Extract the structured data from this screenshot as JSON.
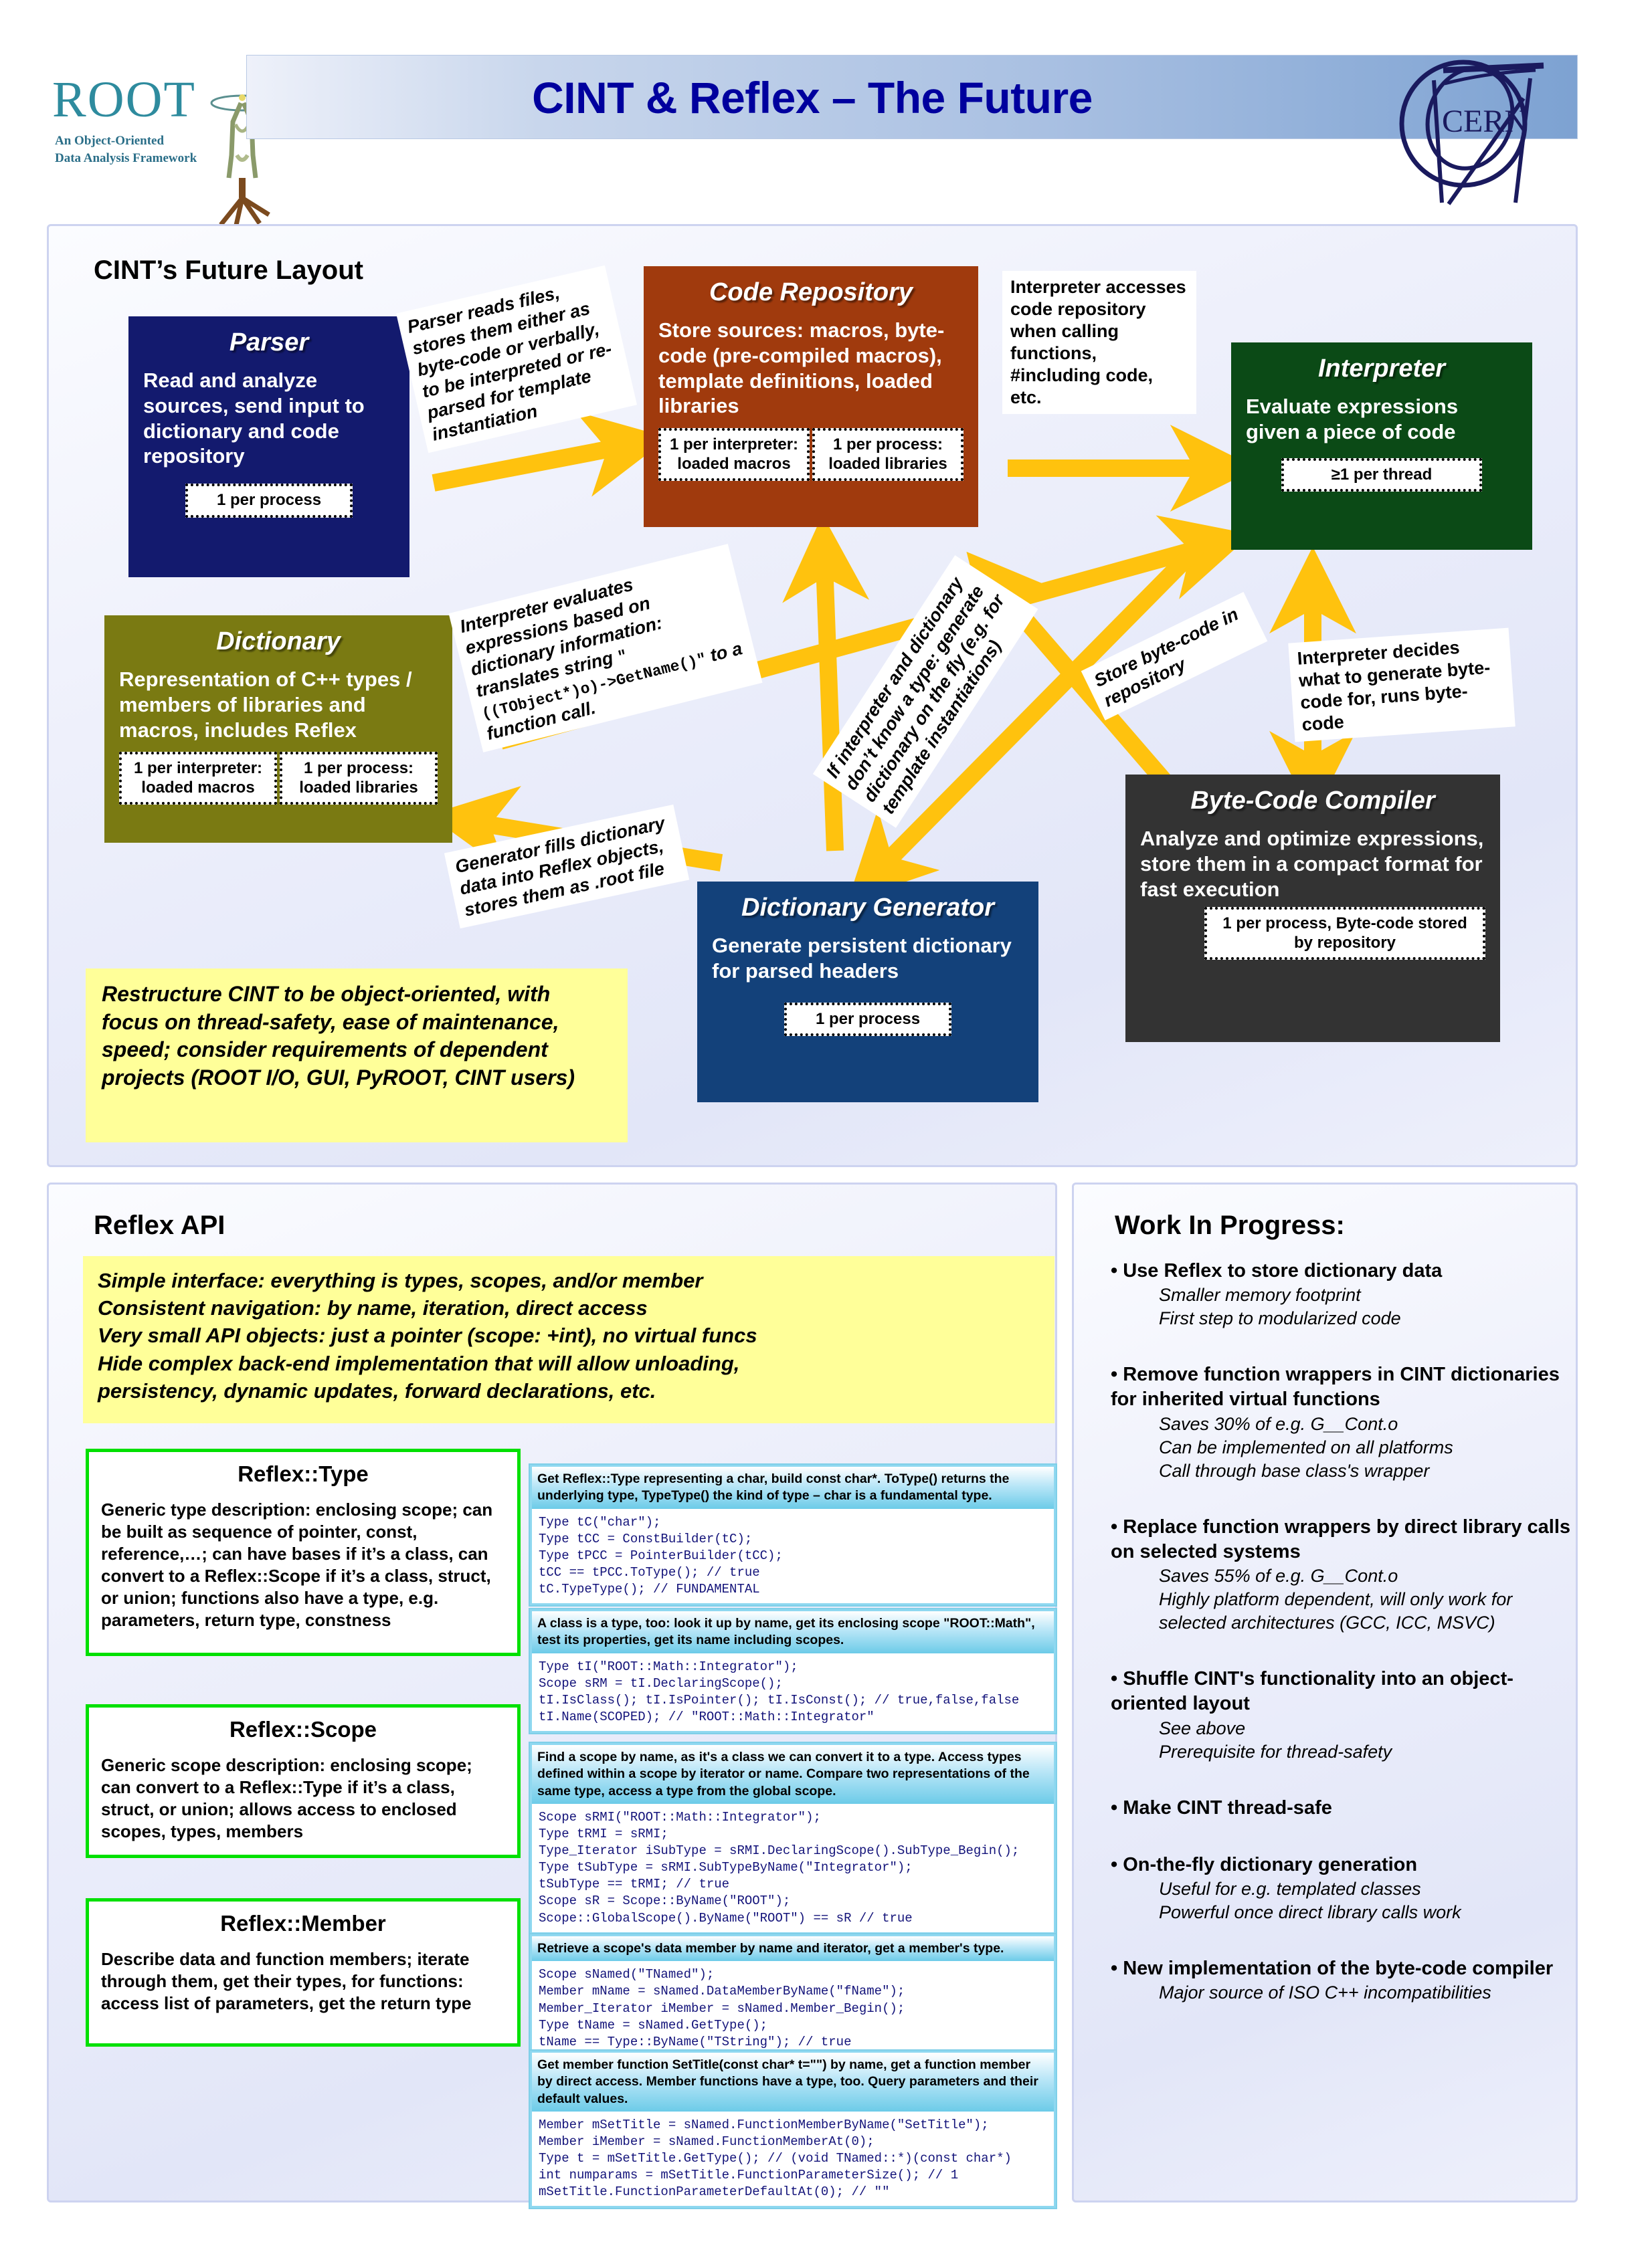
{
  "header": {
    "logo_word": "ROOT",
    "logo_tagline_1": "An Object-Oriented",
    "logo_tagline_2": "Data Analysis Framework",
    "title": "CINT & Reflex – The Future",
    "cern_label": "CERN"
  },
  "colors": {
    "title": "#00009E",
    "parser": "#131A6E",
    "code_repository": "#A03A0D",
    "interpreter": "#0B4A16",
    "dictionary": "#7A7A12",
    "dictionary_generator": "#13417A",
    "byte_code_compiler": "#333333",
    "arrow": "#FFC20E",
    "callout": "#FFFF99",
    "green_border": "#00E000",
    "code_header": "#8FD8F0"
  },
  "diagram": {
    "section_title": "CINT’s Future Layout",
    "boxes": {
      "parser": {
        "title": "Parser",
        "body": "Read and analyze sources, send input to dictionary and code repository",
        "badges": [
          "1 per process"
        ]
      },
      "code_repository": {
        "title": "Code Repository",
        "body": "Store sources: macros, byte-code (pre-compiled macros), template definitions, loaded libraries",
        "badges": [
          "1 per interpreter: loaded macros",
          "1 per process: loaded libraries"
        ]
      },
      "interpreter": {
        "title": "Interpreter",
        "body": "Evaluate expressions given a piece of code",
        "badges": [
          "≥1 per thread"
        ]
      },
      "dictionary": {
        "title": "Dictionary",
        "body": "Representation of C++ types / members of libraries and macros, includes Reflex",
        "badges": [
          "1 per interpreter: loaded macros",
          "1 per process: loaded libraries"
        ]
      },
      "dictionary_generator": {
        "title": "Dictionary Generator",
        "body": "Generate persistent dictionary for parsed headers",
        "badges": [
          "1 per process"
        ]
      },
      "byte_code_compiler": {
        "title": "Byte-Code Compiler",
        "body": "Analyze and optimize expressions, store them in a compact format for fast execution",
        "badges": [
          "1 per process, Byte-code stored by repository"
        ]
      }
    },
    "notes": {
      "parser_reads": "Parser reads files, stores them either as byte-code or verbally, to be interpreted or re-parsed for template instantiation",
      "interpreter_accesses": "Interpreter accesses code repository when calling functions, #including code, etc.",
      "interpreter_evaluates_a": "Interpreter evaluates expressions based on dictionary information: translates string",
      "interpreter_evaluates_code": "\"((TObject*)o)->GetName()\"",
      "interpreter_evaluates_b": "to a function call.",
      "dont_know_type": "If interpreter and dictionary don’t know a type: generate dictionary on the fly (e.g. for template instantiations)",
      "store_bytecode": "Store byte-code in repository",
      "interpreter_decides": "Interpreter decides what to generate byte-code for, runs byte-code",
      "generator_fills": "Generator fills dictionary data into Reflex objects, stores them as .root file"
    },
    "restructure_callout": "Restructure CINT to be object-oriented, with focus on thread-safety, ease of maintenance, speed; consider requirements of dependent projects (ROOT I/O, GUI, PyROOT, CINT users)"
  },
  "reflex": {
    "section_title": "Reflex API",
    "summary_lines": [
      "Simple interface: everything is types, scopes, and/or member",
      "Consistent navigation: by name, iteration, direct access",
      "Very small API objects: just a pointer (scope: +int), no virtual funcs",
      "Hide complex back-end implementation that will allow unloading,",
      "persistency, dynamic updates, forward declarations, etc."
    ],
    "concept_boxes": [
      {
        "title": "Reflex::Type",
        "body": "Generic type description: enclosing scope; can be built as sequence of pointer, const, reference,…; can have bases if it’s a class, can convert to a Reflex::Scope if it’s a class, struct, or union; functions also have a type, e.g. parameters, return type, constness"
      },
      {
        "title": "Reflex::Scope",
        "body": "Generic scope description: enclosing scope; can convert to a Reflex::Type if it’s a class, struct, or union; allows access to enclosed scopes, types, members"
      },
      {
        "title": "Reflex::Member",
        "body": "Describe data and function members; iterate through them, get their types, for functions: access list of parameters, get the return type"
      }
    ],
    "code_blocks": [
      {
        "header": "Get Reflex::Type representing a char, build const char*. ToType() returns the underlying type, TypeType() the kind of type – char is a fundamental type.",
        "code": "Type tC(\"char\");\nType tCC = ConstBuilder(tC);\nType tPCC = PointerBuilder(tCC);\ntCC == tPCC.ToType(); // true\ntC.TypeType(); // FUNDAMENTAL"
      },
      {
        "header": "A class is a type, too: look it up by name, get its enclosing scope \"ROOT::Math\", test its properties, get its name including scopes.",
        "code": "Type tI(\"ROOT::Math::Integrator\");\nScope sRM = tI.DeclaringScope();\ntI.IsClass(); tI.IsPointer(); tI.IsConst(); // true,false,false\ntI.Name(SCOPED); // \"ROOT::Math::Integrator\""
      },
      {
        "header": "Find a scope by name, as it's a class we can convert it to a type. Access types defined within a scope by iterator or name. Compare two representations of the same type, access a type from the global scope.",
        "code": "Scope sRMI(\"ROOT::Math::Integrator\");\nType tRMI = sRMI;\nType_Iterator iSubType = sRMI.DeclaringScope().SubType_Begin();\nType tSubType = sRMI.SubTypeByName(\"Integrator\");\ntSubType == tRMI; // true\nScope sR = Scope::ByName(\"ROOT\");\nScope::GlobalScope().ByName(\"ROOT\") == sR // true"
      },
      {
        "header": "Retrieve a scope's data member by name and iterator, get a member's type.",
        "code": "Scope sNamed(\"TNamed\");\nMember mName = sNamed.DataMemberByName(\"fName\");\nMember_Iterator iMember = sNamed.Member_Begin();\nType tName = sNamed.GetType();\ntName == Type::ByName(\"TString\"); // true"
      },
      {
        "header": "Get member function SetTitle(const char* t=\"\") by name, get a function member by direct access. Member functions have a type, too. Query parameters and their default values.",
        "code": "Member mSetTitle = sNamed.FunctionMemberByName(\"SetTitle\");\nMember iMember = sNamed.FunctionMemberAt(0);\nType t = mSetTitle.GetType(); // (void TNamed::*)(const char*)\nint numparams = mSetTitle.FunctionParameterSize(); // 1\nmSetTitle.FunctionParameterDefaultAt(0); // \"\""
      }
    ]
  },
  "work_in_progress": {
    "section_title": "Work In Progress:",
    "items": [
      {
        "bullet": "• Use Reflex to store dictionary data",
        "subs": [
          "Smaller memory footprint",
          "First step to modularized code"
        ]
      },
      {
        "bullet": "• Remove function wrappers in CINT dictionaries for inherited virtual functions",
        "subs": [
          "Saves 30% of e.g. G__Cont.o",
          "Can be implemented on all platforms",
          "Call through base class's wrapper"
        ]
      },
      {
        "bullet": "• Replace function wrappers by direct library calls on selected systems",
        "subs": [
          "Saves 55% of e.g. G__Cont.o",
          "Highly platform dependent, will only work for selected architectures (GCC, ICC, MSVC)"
        ]
      },
      {
        "bullet": "• Shuffle CINT's functionality into an object-oriented layout",
        "subs": [
          "See above",
          "Prerequisite for thread-safety"
        ]
      },
      {
        "bullet": "• Make CINT thread-safe",
        "subs": []
      },
      {
        "bullet": "• On-the-fly dictionary generation",
        "subs": [
          "Useful for e.g. templated classes",
          "Powerful once direct library calls work"
        ]
      },
      {
        "bullet": "• New implementation of the byte-code compiler",
        "subs": [
          "Major source of ISO C++ incompatibilities"
        ]
      }
    ]
  }
}
